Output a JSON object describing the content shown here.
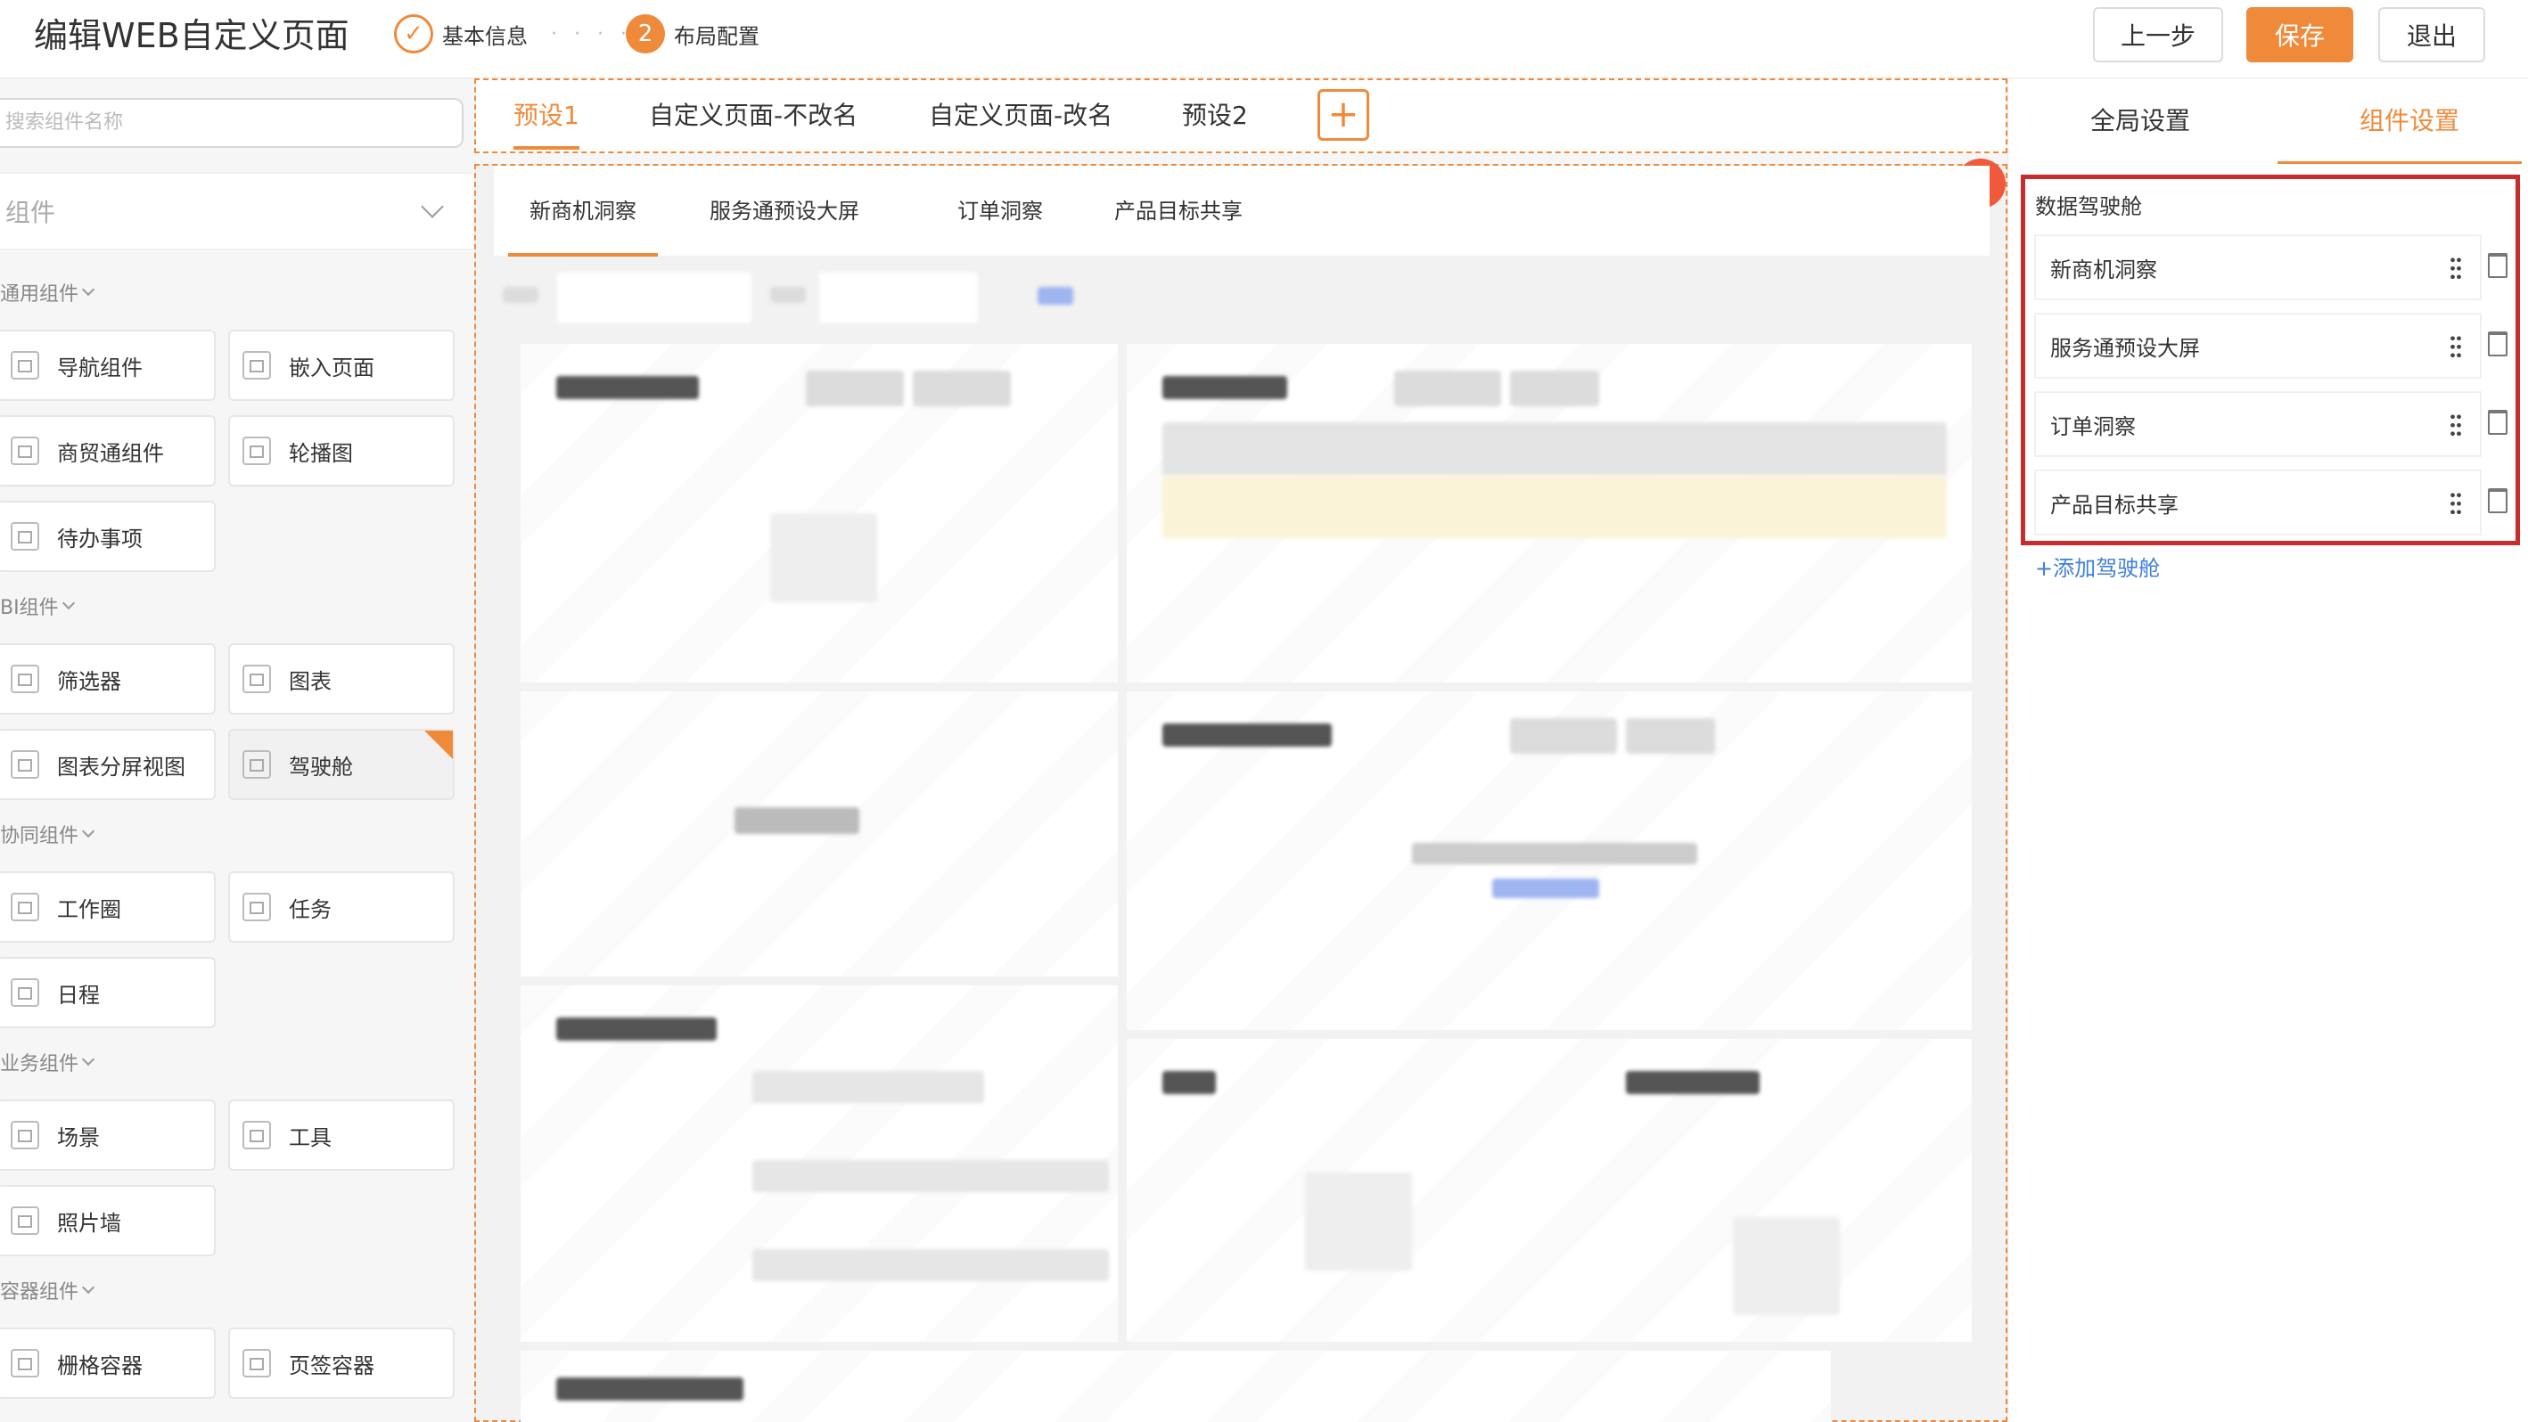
{
  "header": {
    "title": "编辑WEB自定义页面",
    "steps": [
      {
        "icon": "check-circle-icon",
        "label": "基本信息"
      },
      {
        "number": "2",
        "label": "布局配置"
      }
    ],
    "dots": "· · · ·",
    "buttons": {
      "prev": "上一步",
      "save": "保存",
      "exit": "退出"
    },
    "accent_color": "#f08a3b"
  },
  "sidebar": {
    "search_placeholder": "搜索组件名称",
    "collapse_title": "组件",
    "groups": [
      {
        "title": "通用组件",
        "items": [
          "导航组件",
          "嵌入页面",
          "商贸通组件",
          "轮播图",
          "待办事项"
        ]
      },
      {
        "title": "BI组件",
        "items": [
          "筛选器",
          "图表",
          "图表分屏视图",
          "驾驶舱"
        ]
      },
      {
        "title": "协同组件",
        "items": [
          "工作圈",
          "任务",
          "日程"
        ]
      },
      {
        "title": "业务组件",
        "items": [
          "场景",
          "工具",
          "照片墙"
        ]
      },
      {
        "title": "容器组件",
        "items": [
          "栅格容器",
          "页签容器"
        ]
      }
    ],
    "selected_item": "驾驶舱"
  },
  "canvas": {
    "page_tabs": [
      "预设1",
      "自定义页面-不改名",
      "自定义页面-改名",
      "预设2"
    ],
    "active_page_tab": "预设1",
    "add_tab_label": "+",
    "close_label": "×",
    "cockpit_tabs": [
      "新商机洞察",
      "服务通预设大屏",
      "订单洞察",
      "产品目标共享"
    ],
    "active_cockpit_tab": "新商机洞察"
  },
  "right_panel": {
    "tabs": [
      "全局设置",
      "组件设置"
    ],
    "active_tab": "组件设置",
    "section_label": "数据驾驶舱",
    "items": [
      "新商机洞察",
      "服务通预设大屏",
      "订单洞察",
      "产品目标共享"
    ],
    "add_link": "+添加驾驶舱",
    "highlight_color": "#c62e2e"
  }
}
